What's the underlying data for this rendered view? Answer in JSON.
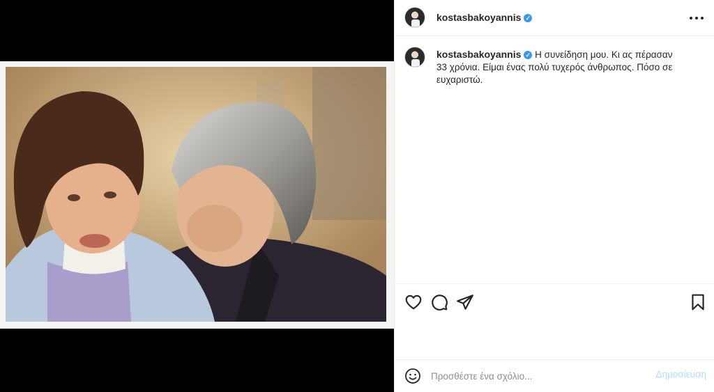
{
  "post": {
    "username": "kostasbakoyannis",
    "verified_icon": "verified-badge-icon",
    "caption_username": "kostasbakoyannis",
    "caption": "Η συνείδηση μου. Κι ας πέρασαν 33 χρόνια. Είμαι ένας πολύ τυχερός άνθρωπος. Πόσο σε ευχαριστώ."
  },
  "actions": {
    "icons": [
      "heart-icon",
      "comment-icon",
      "share-icon",
      "bookmark-icon"
    ]
  },
  "comment": {
    "placeholder": "Προσθέστε ένα σχόλιο...",
    "post_label": "Δημοσίευση"
  },
  "colors": {
    "accent": "#0095f6",
    "accent_disabled": "#b3dbff",
    "verified": "#3897f0",
    "border": "#efefef"
  }
}
